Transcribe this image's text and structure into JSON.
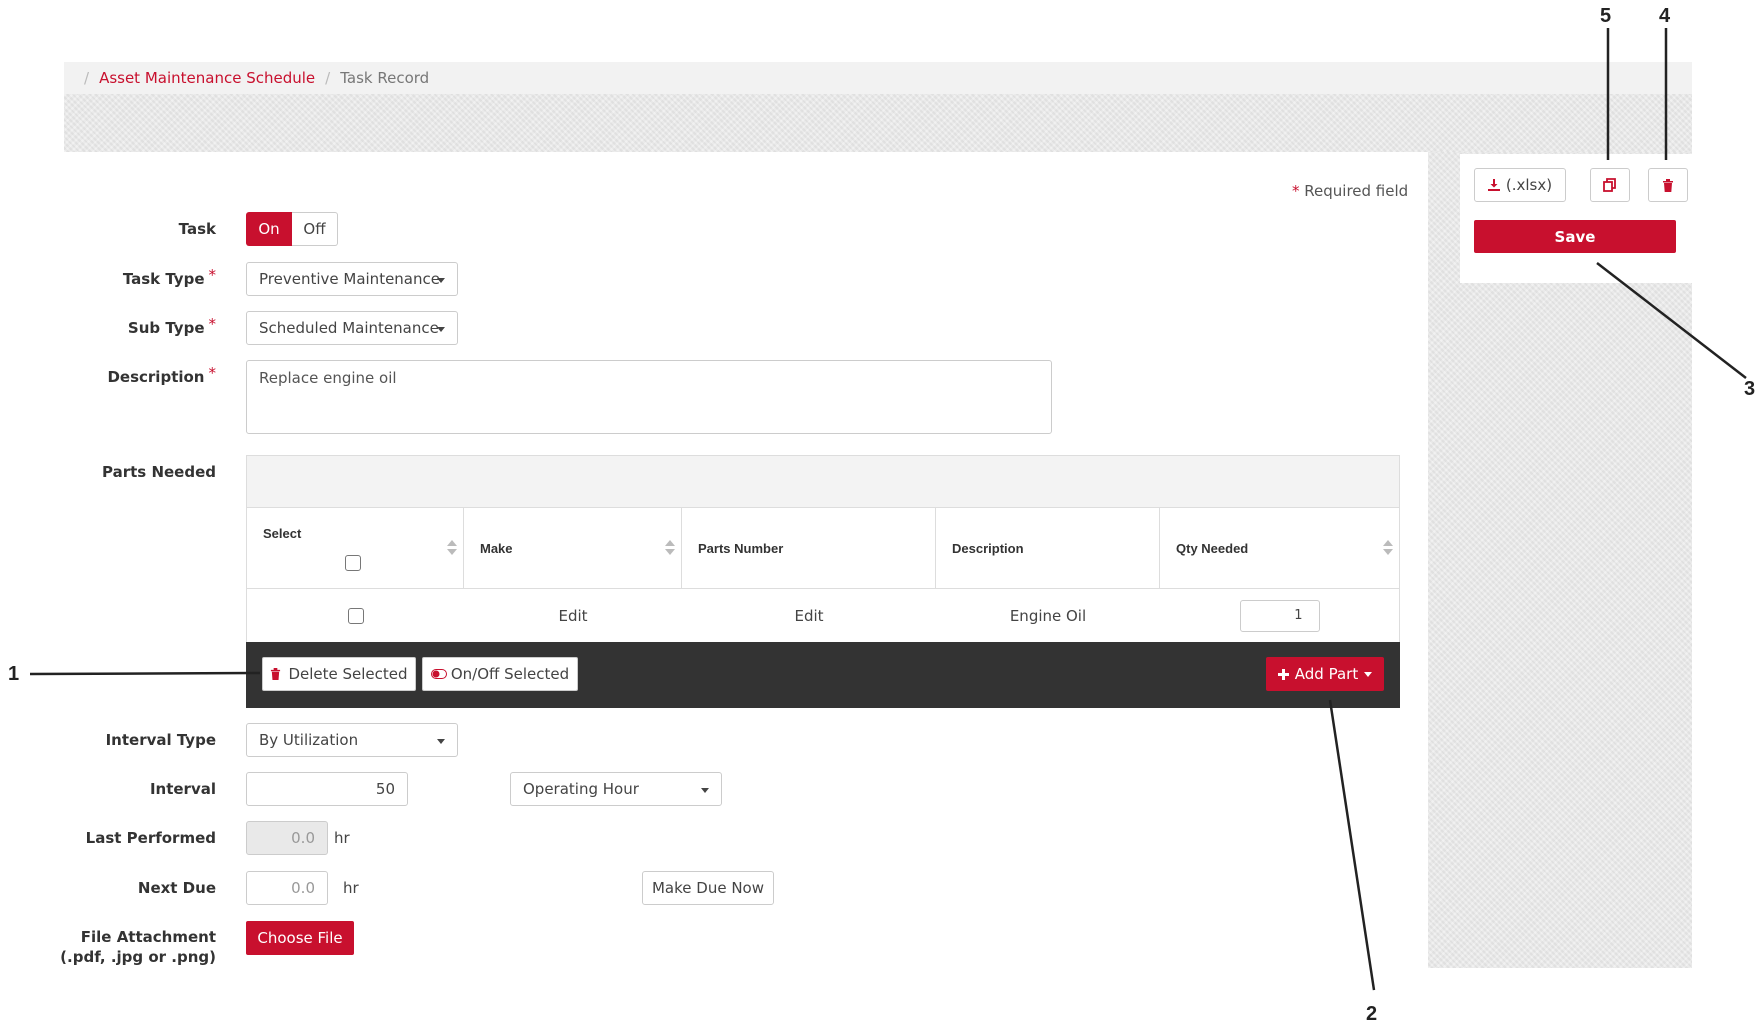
{
  "breadcrumb": {
    "items": [
      {
        "label": "Asset Maintenance Schedule"
      },
      {
        "label": "Task Record"
      }
    ]
  },
  "actions": {
    "export_label": "(.xlsx)",
    "save_label": "Save",
    "export_icon": "download-icon",
    "copy_icon": "copy-icon",
    "delete_icon": "trash-icon"
  },
  "form": {
    "required_note": "Required field",
    "required_marker": "*",
    "task": {
      "label": "Task",
      "on": "On",
      "off": "Off",
      "selected": "On"
    },
    "task_type": {
      "label": "Task Type",
      "value": "Preventive Maintenance"
    },
    "sub_type": {
      "label": "Sub Type",
      "value": "Scheduled Maintenance"
    },
    "description": {
      "label": "Description",
      "value": "Replace engine oil"
    },
    "parts_needed": {
      "label": "Parts Needed"
    },
    "interval_type": {
      "label": "Interval Type",
      "value": "By Utilization"
    },
    "interval": {
      "label": "Interval",
      "value": "50",
      "unit_value": "Operating Hour"
    },
    "last_performed": {
      "label": "Last Performed",
      "value": "0.0",
      "unit": "hr"
    },
    "next_due": {
      "label": "Next Due",
      "placeholder": "0.0",
      "unit": "hr",
      "make_due_label": "Make Due Now"
    },
    "file_attachment": {
      "label_line1": "File Attachment",
      "label_line2": "(.pdf, .jpg or .png)",
      "button": "Choose File"
    }
  },
  "parts_table": {
    "columns": [
      "Select",
      "Make",
      "Parts Number",
      "Description",
      "Qty Needed"
    ],
    "rows": [
      {
        "make": "Edit",
        "parts_number": "Edit",
        "description": "Engine Oil",
        "qty": "1"
      }
    ],
    "footer": {
      "delete_selected": "Delete Selected",
      "onoff_selected": "On/Off Selected",
      "add_part": "Add Part"
    }
  },
  "callouts": [
    "1",
    "2",
    "3",
    "4",
    "5"
  ],
  "colors": {
    "accent": "#c8102e",
    "footer_bar": "#333333"
  }
}
